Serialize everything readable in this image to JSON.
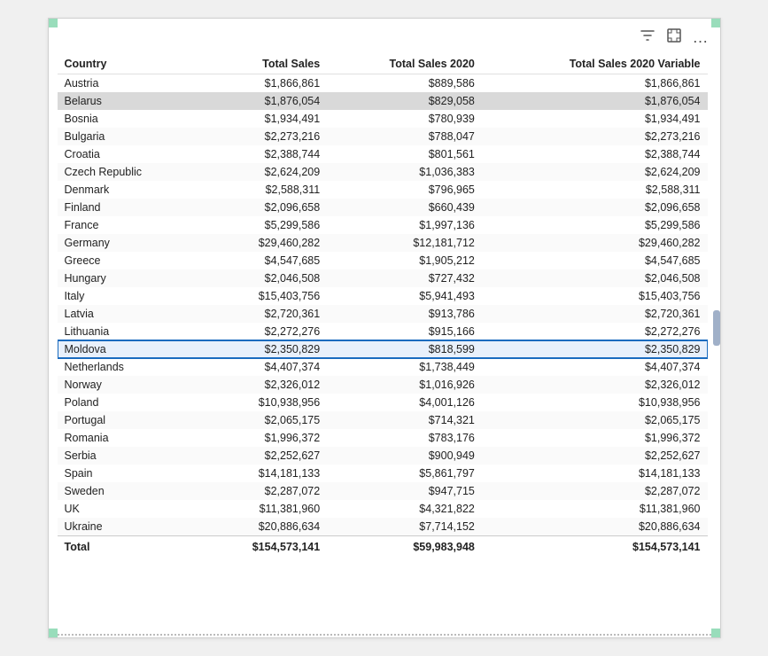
{
  "toolbar": {
    "filter_icon": "⊿",
    "expand_icon": "⤢",
    "more_icon": "⋯"
  },
  "table": {
    "columns": [
      "Country",
      "Total Sales",
      "Total Sales 2020",
      "Total Sales 2020 Variable"
    ],
    "rows": [
      {
        "country": "Austria",
        "total_sales": "$1,866,861",
        "ts2020": "$889,586",
        "ts2020var": "$1,866,861",
        "highlighted": false,
        "selected": false
      },
      {
        "country": "Belarus",
        "total_sales": "$1,876,054",
        "ts2020": "$829,058",
        "ts2020var": "$1,876,054",
        "highlighted": true,
        "selected": false
      },
      {
        "country": "Bosnia",
        "total_sales": "$1,934,491",
        "ts2020": "$780,939",
        "ts2020var": "$1,934,491",
        "highlighted": false,
        "selected": false
      },
      {
        "country": "Bulgaria",
        "total_sales": "$2,273,216",
        "ts2020": "$788,047",
        "ts2020var": "$2,273,216",
        "highlighted": false,
        "selected": false
      },
      {
        "country": "Croatia",
        "total_sales": "$2,388,744",
        "ts2020": "$801,561",
        "ts2020var": "$2,388,744",
        "highlighted": false,
        "selected": false
      },
      {
        "country": "Czech Republic",
        "total_sales": "$2,624,209",
        "ts2020": "$1,036,383",
        "ts2020var": "$2,624,209",
        "highlighted": false,
        "selected": false
      },
      {
        "country": "Denmark",
        "total_sales": "$2,588,311",
        "ts2020": "$796,965",
        "ts2020var": "$2,588,311",
        "highlighted": false,
        "selected": false
      },
      {
        "country": "Finland",
        "total_sales": "$2,096,658",
        "ts2020": "$660,439",
        "ts2020var": "$2,096,658",
        "highlighted": false,
        "selected": false
      },
      {
        "country": "France",
        "total_sales": "$5,299,586",
        "ts2020": "$1,997,136",
        "ts2020var": "$5,299,586",
        "highlighted": false,
        "selected": false
      },
      {
        "country": "Germany",
        "total_sales": "$29,460,282",
        "ts2020": "$12,181,712",
        "ts2020var": "$29,460,282",
        "highlighted": false,
        "selected": false
      },
      {
        "country": "Greece",
        "total_sales": "$4,547,685",
        "ts2020": "$1,905,212",
        "ts2020var": "$4,547,685",
        "highlighted": false,
        "selected": false
      },
      {
        "country": "Hungary",
        "total_sales": "$2,046,508",
        "ts2020": "$727,432",
        "ts2020var": "$2,046,508",
        "highlighted": false,
        "selected": false
      },
      {
        "country": "Italy",
        "total_sales": "$15,403,756",
        "ts2020": "$5,941,493",
        "ts2020var": "$15,403,756",
        "highlighted": false,
        "selected": false
      },
      {
        "country": "Latvia",
        "total_sales": "$2,720,361",
        "ts2020": "$913,786",
        "ts2020var": "$2,720,361",
        "highlighted": false,
        "selected": false
      },
      {
        "country": "Lithuania",
        "total_sales": "$2,272,276",
        "ts2020": "$915,166",
        "ts2020var": "$2,272,276",
        "highlighted": false,
        "selected": false
      },
      {
        "country": "Moldova",
        "total_sales": "$2,350,829",
        "ts2020": "$818,599",
        "ts2020var": "$2,350,829",
        "highlighted": false,
        "selected": true
      },
      {
        "country": "Netherlands",
        "total_sales": "$4,407,374",
        "ts2020": "$1,738,449",
        "ts2020var": "$4,407,374",
        "highlighted": false,
        "selected": false
      },
      {
        "country": "Norway",
        "total_sales": "$2,326,012",
        "ts2020": "$1,016,926",
        "ts2020var": "$2,326,012",
        "highlighted": false,
        "selected": false
      },
      {
        "country": "Poland",
        "total_sales": "$10,938,956",
        "ts2020": "$4,001,126",
        "ts2020var": "$10,938,956",
        "highlighted": false,
        "selected": false
      },
      {
        "country": "Portugal",
        "total_sales": "$2,065,175",
        "ts2020": "$714,321",
        "ts2020var": "$2,065,175",
        "highlighted": false,
        "selected": false
      },
      {
        "country": "Romania",
        "total_sales": "$1,996,372",
        "ts2020": "$783,176",
        "ts2020var": "$1,996,372",
        "highlighted": false,
        "selected": false
      },
      {
        "country": "Serbia",
        "total_sales": "$2,252,627",
        "ts2020": "$900,949",
        "ts2020var": "$2,252,627",
        "highlighted": false,
        "selected": false
      },
      {
        "country": "Spain",
        "total_sales": "$14,181,133",
        "ts2020": "$5,861,797",
        "ts2020var": "$14,181,133",
        "highlighted": false,
        "selected": false
      },
      {
        "country": "Sweden",
        "total_sales": "$2,287,072",
        "ts2020": "$947,715",
        "ts2020var": "$2,287,072",
        "highlighted": false,
        "selected": false
      },
      {
        "country": "UK",
        "total_sales": "$11,381,960",
        "ts2020": "$4,321,822",
        "ts2020var": "$11,381,960",
        "highlighted": false,
        "selected": false
      },
      {
        "country": "Ukraine",
        "total_sales": "$20,886,634",
        "ts2020": "$7,714,152",
        "ts2020var": "$20,886,634",
        "highlighted": false,
        "selected": false
      }
    ],
    "total": {
      "label": "Total",
      "total_sales": "$154,573,141",
      "ts2020": "$59,983,948",
      "ts2020var": "$154,573,141"
    }
  }
}
